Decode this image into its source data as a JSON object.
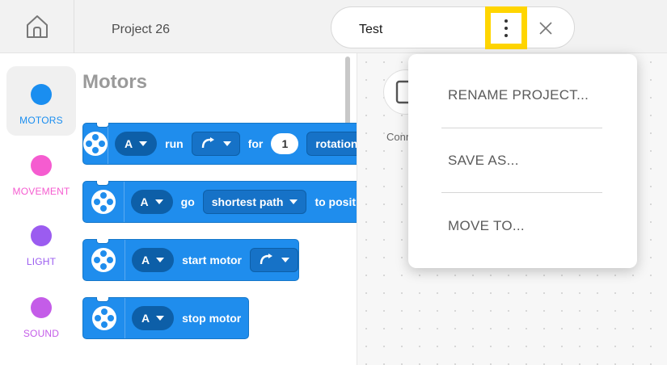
{
  "tabs": [
    {
      "title": "Project 26"
    },
    {
      "title": "Test"
    }
  ],
  "categories": [
    {
      "label": "MOTORS",
      "color": "#1a8ef0",
      "active": true
    },
    {
      "label": "MOVEMENT",
      "color": "#f55cd0",
      "active": false
    },
    {
      "label": "LIGHT",
      "color": "#9b5cf0",
      "active": false
    },
    {
      "label": "SOUND",
      "color": "#c45ce8",
      "active": false
    }
  ],
  "palette": {
    "heading": "Motors",
    "blocks": [
      {
        "port": "A",
        "verb": "run",
        "dir_icon": "clockwise-arrow-icon",
        "for": "for",
        "amount": "1",
        "unit": "rotations"
      },
      {
        "port": "A",
        "verb": "go",
        "option": "shortest path",
        "tail": "to position"
      },
      {
        "port": "A",
        "verb": "start motor",
        "dir_icon": "clockwise-arrow-icon"
      },
      {
        "port": "A",
        "verb": "stop motor"
      }
    ]
  },
  "canvas": {
    "connect_label": "Connect"
  },
  "menu": {
    "items": [
      "RENAME PROJECT...",
      "SAVE AS...",
      "MOVE TO..."
    ]
  },
  "colors": {
    "accent_highlight": "#ffd500",
    "block_blue": "#1f8ded",
    "block_dark": "#0d5fa8"
  }
}
